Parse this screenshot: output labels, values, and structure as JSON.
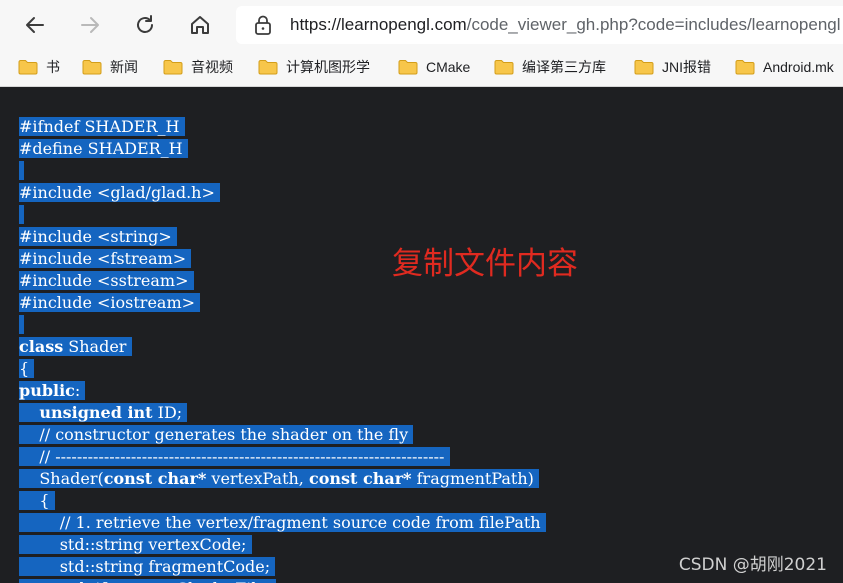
{
  "browser": {
    "url_main": "https://learnopengl.com",
    "url_rest": "/code_viewer_gh.php?code=includes/learnopengl"
  },
  "bookmarks": [
    "书",
    "新闻",
    "音视频",
    "计算机图形学",
    "CMake",
    "编译第三方库",
    "JNI报错",
    "Android.mk"
  ],
  "code_lines": [
    [
      {
        "t": "#ifndef SHADER_H"
      }
    ],
    [
      {
        "t": "#define SHADER_H"
      }
    ],
    [
      {
        "t": ""
      }
    ],
    [
      {
        "t": "#include <glad/glad.h>"
      }
    ],
    [
      {
        "t": ""
      }
    ],
    [
      {
        "t": "#include <string>"
      }
    ],
    [
      {
        "t": "#include <fstream>"
      }
    ],
    [
      {
        "t": "#include <sstream>"
      }
    ],
    [
      {
        "t": "#include <iostream>"
      }
    ],
    [
      {
        "t": ""
      }
    ],
    [
      {
        "t": "class",
        "kw": true
      },
      {
        "t": " Shader"
      }
    ],
    [
      {
        "t": "{"
      }
    ],
    [
      {
        "t": "public",
        "kw": true
      },
      {
        "t": ":"
      }
    ],
    [
      {
        "t": "    "
      },
      {
        "t": "unsigned int",
        "kw": true
      },
      {
        "t": " ID;"
      }
    ],
    [
      {
        "t": "    // constructor generates the shader on the fly"
      }
    ],
    [
      {
        "t": "    // ------------------------------------------------------------------------"
      }
    ],
    [
      {
        "t": "    Shader("
      },
      {
        "t": "const char*",
        "kw": true
      },
      {
        "t": " vertexPath, "
      },
      {
        "t": "const char*",
        "kw": true
      },
      {
        "t": " fragmentPath)"
      }
    ],
    [
      {
        "t": "    {"
      }
    ],
    [
      {
        "t": "        // 1. retrieve the vertex/fragment source code from filePath"
      }
    ],
    [
      {
        "t": "        std::string vertexCode;"
      }
    ],
    [
      {
        "t": "        std::string fragmentCode;"
      }
    ],
    [
      {
        "t": "        std::ifstream vShaderFile;"
      }
    ]
  ],
  "annotation": "复制文件内容",
  "watermark": "CSDN @胡刚2021",
  "colors": {
    "selection": "#1565c0",
    "annotation": "#e02a20",
    "background": "#1e1f22"
  }
}
